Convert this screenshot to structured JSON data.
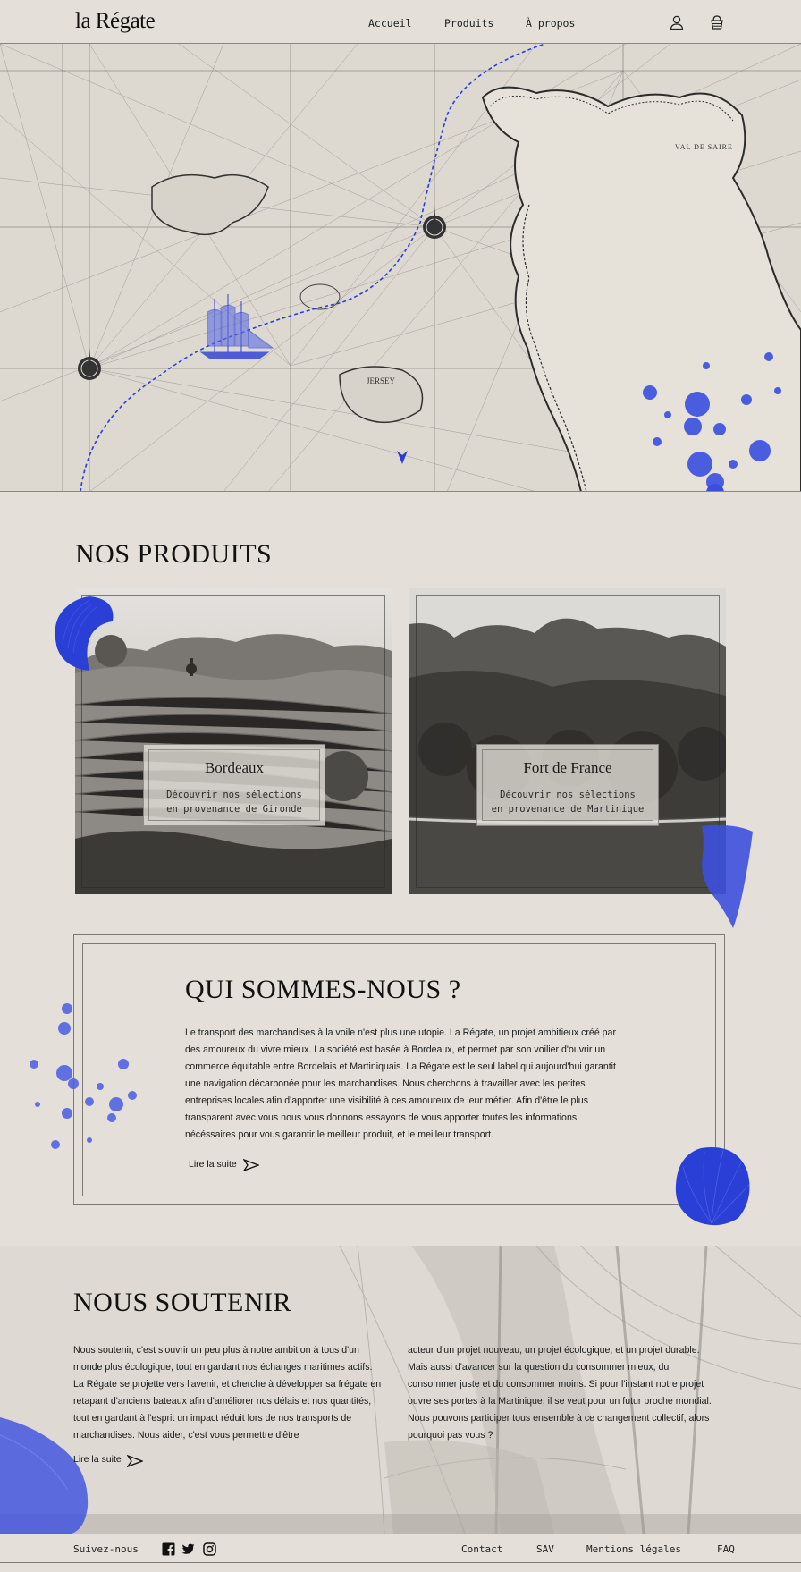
{
  "header": {
    "logo": "la Régate",
    "nav": [
      {
        "label": "Accueil"
      },
      {
        "label": "Produits"
      },
      {
        "label": "À propos"
      }
    ],
    "icons": [
      "user-icon",
      "basket-icon"
    ]
  },
  "hero": {
    "image": "Antique nautical chart with compass roses, a tall-ship illustration and a dashed sailing route",
    "accent_color": "#2a3fd6"
  },
  "products": {
    "title": "NOS PRODUITS",
    "cards": [
      {
        "city": "Bordeaux",
        "desc": "Découvrir nos sélections\nen provenance de Gironde"
      },
      {
        "city": "Fort de France",
        "desc": "Découvrir nos sélections\nen provenance de Martinique"
      }
    ]
  },
  "about": {
    "title": "QUI SOMMES-NOUS ?",
    "text": "Le transport des marchandises à la voile n'est plus une utopie. La Régate, un projet ambitieux créé par des amoureux du vivre mieux. La société est basée à Bordeaux, et permet par son voilier d'ouvrir un commerce équitable entre Bordelais et Martiniquais. La Régate est le seul label qui aujourd'hui garantit une navigation décarbonée pour les marchandises. Nous cherchons à travailler avec les petites entreprises locales afin d'apporter une visibilité à ces amoureux de leur métier. Afin d'être le plus transparent avec vous nous vous donnons essayons de vous apporter toutes les informations nécéssaires pour vous garantir le meilleur produit, et le meilleur transport.",
    "read_more": "Lire la suite"
  },
  "support": {
    "title": "NOUS SOUTENIR",
    "col1": "Nous soutenir, c'est s'ouvrir un peu plus à notre ambition à tous d'un monde plus écologique, tout en gardant nos échanges maritimes actifs. La Régate se projette vers l'avenir, et cherche à développer sa frégate en retapant d'anciens bateaux afin d'améliorer nos délais et nos quantités, tout en gardant à l'esprit un impact réduit lors de nos transports de marchandises. Nous aider, c'est vous permettre d'être",
    "col2": "acteur d'un projet nouveau, un projet écologique, et un projet durable. Mais aussi d'avancer sur la question du consommer mieux, du consommer juste et du consommer moins. Si pour l'instant notre projet ouvre ses portes à la Martinique, il se veut pour un futur proche mondial. Nous pouvons participer tous ensemble à ce changement collectif,  alors pourquoi pas vous ?",
    "read_more": "Lire la suite"
  },
  "footer": {
    "follow": "Suivez-nous",
    "social": [
      "facebook-icon",
      "twitter-icon",
      "instagram-icon"
    ],
    "links": [
      {
        "label": "Contact"
      },
      {
        "label": "SAV"
      },
      {
        "label": "Mentions légales"
      },
      {
        "label": "FAQ"
      }
    ]
  },
  "colors": {
    "background": "#e4e0d9",
    "ink": "#1a1a1a",
    "accent_blue": "#2a3fd6"
  }
}
